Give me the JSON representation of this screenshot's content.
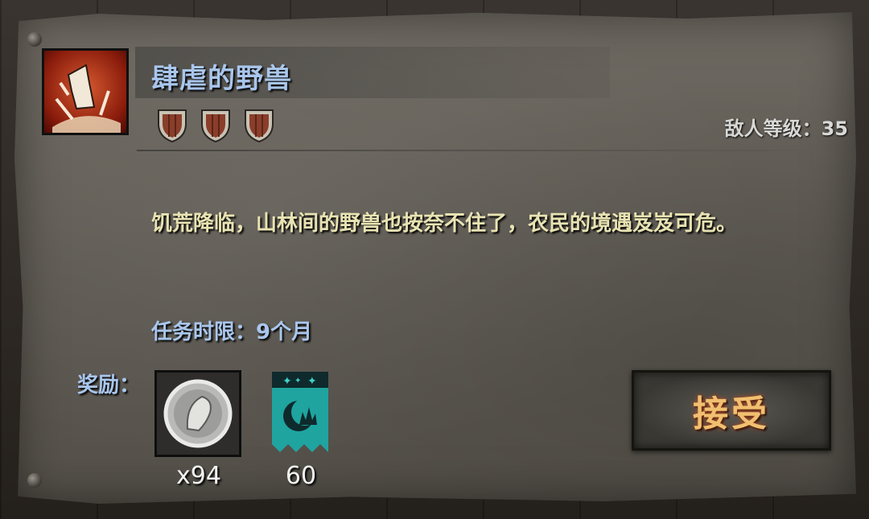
{
  "quest": {
    "title": "肆虐的野兽",
    "difficulty_shields": 3,
    "enemy_level_label": "敌人等级：35",
    "description": "饥荒降临，山林间的野兽也按奈不住了，农民的境遇岌岌可危。",
    "time_limit": "任务时限：9个月"
  },
  "rewards": {
    "label": "奖励：",
    "items": [
      {
        "icon": "silver-coin-icon",
        "count": "x94"
      },
      {
        "icon": "moon-banner-icon",
        "count": "60"
      }
    ]
  },
  "actions": {
    "accept_label": "接受"
  },
  "colors": {
    "title": "#a9c6ec",
    "description": "#e8e3b2",
    "accept_text": "#f0c070",
    "banner": "#1fa4a0"
  }
}
